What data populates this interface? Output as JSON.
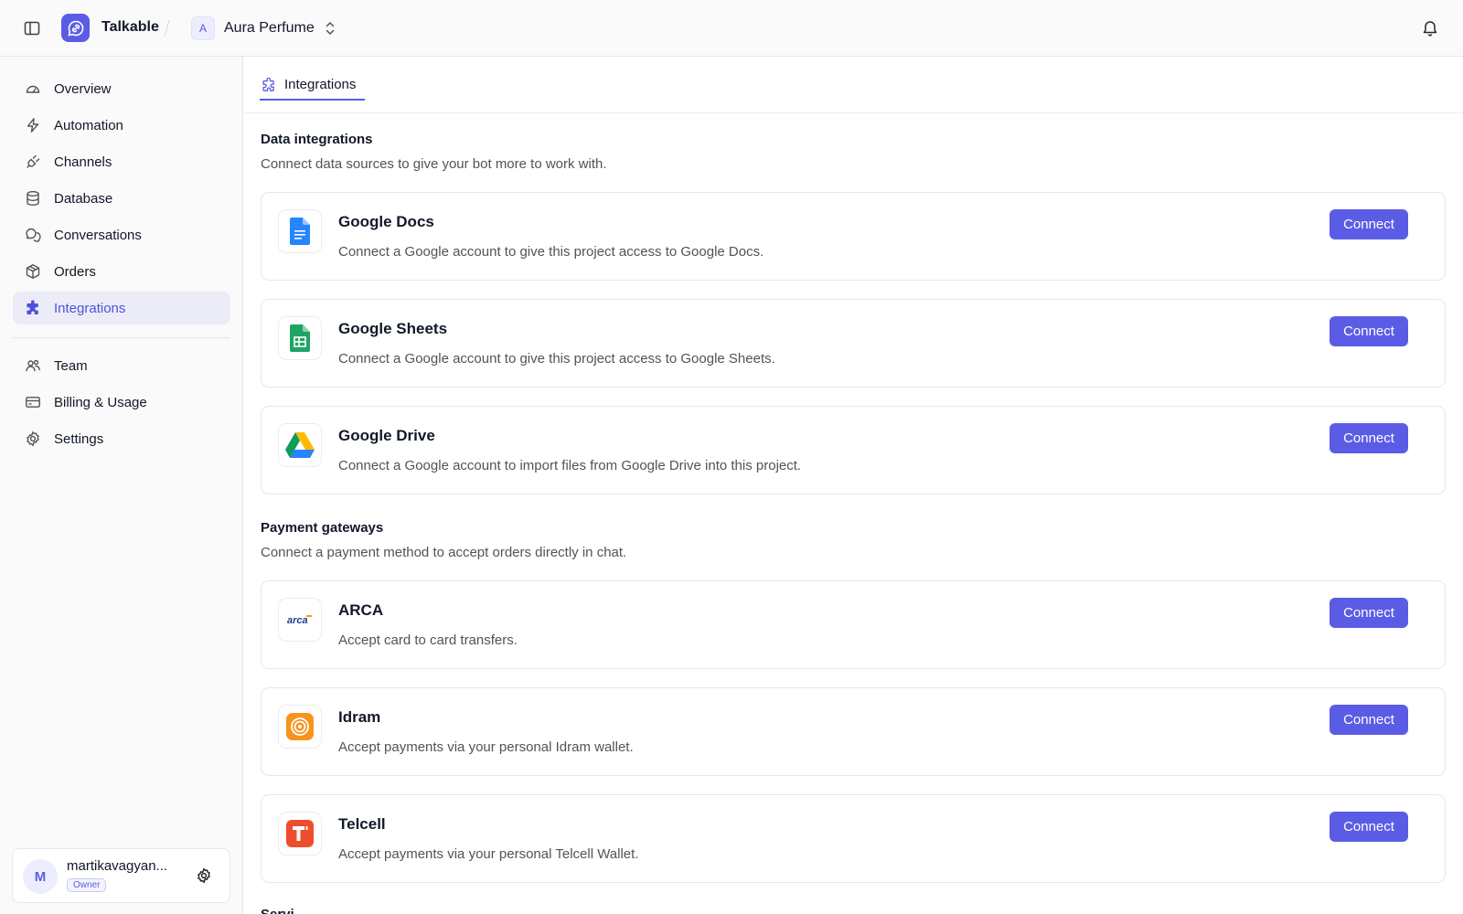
{
  "topbar": {
    "brand_name": "Talkable",
    "project_initial": "A",
    "project_name": "Aura Perfume"
  },
  "sidebar": {
    "items": [
      {
        "label": "Overview",
        "icon": "gauge-icon"
      },
      {
        "label": "Automation",
        "icon": "lightning-icon"
      },
      {
        "label": "Channels",
        "icon": "plug-icon"
      },
      {
        "label": "Database",
        "icon": "database-icon"
      },
      {
        "label": "Conversations",
        "icon": "chat-bubbles-icon"
      },
      {
        "label": "Orders",
        "icon": "package-icon"
      },
      {
        "label": "Integrations",
        "icon": "puzzle-icon",
        "active": true
      }
    ],
    "items_secondary": [
      {
        "label": "Team",
        "icon": "team-icon"
      },
      {
        "label": "Billing & Usage",
        "icon": "credit-card-icon"
      },
      {
        "label": "Settings",
        "icon": "gear-icon"
      }
    ],
    "user": {
      "initial": "M",
      "name": "martikavagyan...",
      "role": "Owner"
    }
  },
  "tabs": [
    {
      "label": "Integrations",
      "icon": "puzzle-icon",
      "active": true
    }
  ],
  "sections": {
    "data": {
      "title": "Data integrations",
      "description": "Connect data sources to give your bot more to work with.",
      "cards": [
        {
          "title": "Google Docs",
          "description": "Connect a Google account to give this project access to Google Docs.",
          "button": "Connect",
          "icon": "google-docs-icon"
        },
        {
          "title": "Google Sheets",
          "description": "Connect a Google account to give this project access to Google Sheets.",
          "button": "Connect",
          "icon": "google-sheets-icon"
        },
        {
          "title": "Google Drive",
          "description": "Connect a Google account to import files from Google Drive into this project.",
          "button": "Connect",
          "icon": "google-drive-icon"
        }
      ]
    },
    "payments": {
      "title": "Payment gateways",
      "description": "Connect a payment method to accept orders directly in chat.",
      "cards": [
        {
          "title": "ARCA",
          "description": "Accept card to card transfers.",
          "button": "Connect",
          "icon": "arca-logo-icon",
          "logo_text": "arca"
        },
        {
          "title": "Idram",
          "description": "Accept payments via your personal Idram wallet.",
          "button": "Connect",
          "icon": "idram-logo-icon"
        },
        {
          "title": "Telcell",
          "description": "Accept payments via your personal Telcell Wallet.",
          "button": "Connect",
          "icon": "telcell-logo-icon"
        }
      ]
    },
    "next_title": "Servi"
  },
  "colors": {
    "accent": "#5b5ce6",
    "active_nav_bg": "#ebecf7",
    "docs_blue": "#2684fc",
    "sheets_green": "#1fa463",
    "idram_orange": "#f7941d",
    "telcell_red": "#ee4d2d"
  }
}
